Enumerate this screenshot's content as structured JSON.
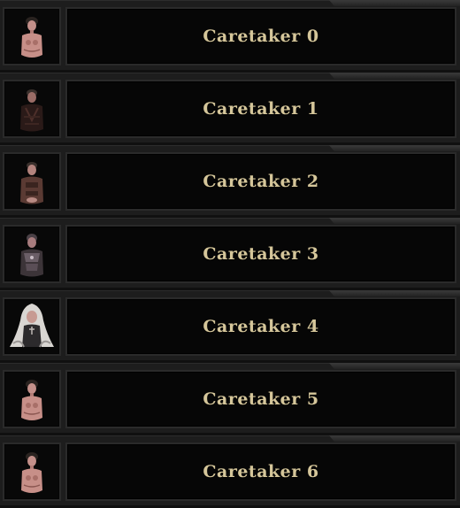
{
  "caretakers": [
    {
      "name": "Caretaker 0",
      "portrait": "nude-woman-portrait-icon"
    },
    {
      "name": "Caretaker 1",
      "portrait": "dark-robed-woman-portrait-icon"
    },
    {
      "name": "Caretaker 2",
      "portrait": "leather-clad-woman-portrait-icon"
    },
    {
      "name": "Caretaker 3",
      "portrait": "armored-woman-portrait-icon"
    },
    {
      "name": "Caretaker 4",
      "portrait": "white-haired-nun-portrait-icon"
    },
    {
      "name": "Caretaker 5",
      "portrait": "nude-woman-portrait-icon"
    },
    {
      "name": "Caretaker 6",
      "portrait": "nude-woman-portrait-icon"
    }
  ],
  "colors": {
    "label": "#d5c69a",
    "row_background": "#1d1d1d",
    "panel_background": "#060606",
    "border": "#2a2a2a"
  }
}
